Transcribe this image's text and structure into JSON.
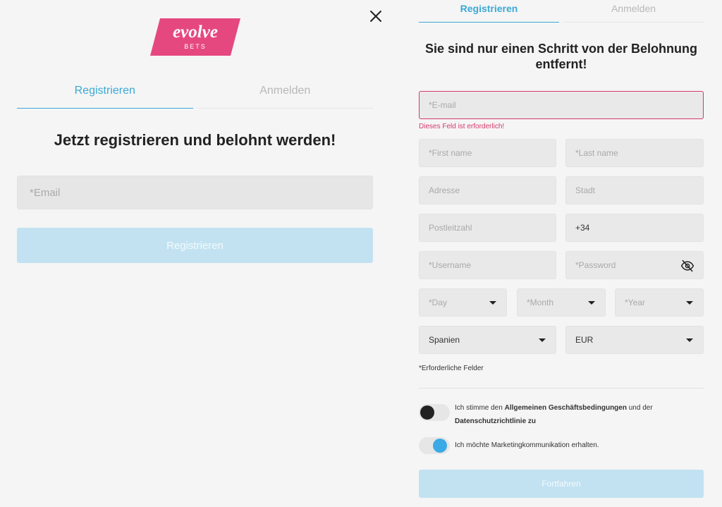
{
  "brand": {
    "logo_word": "evolve",
    "logo_sub": "BETS",
    "logo_color": "#e5487f"
  },
  "close_icon": "close-icon",
  "left_panel": {
    "tabs": [
      {
        "label": "Registrieren",
        "active": true
      },
      {
        "label": "Anmelden",
        "active": false
      }
    ],
    "headline": "Jetzt registrieren und belohnt werden!",
    "email_placeholder": "*Email",
    "submit_label": "Registrieren"
  },
  "right_panel": {
    "tabs": [
      {
        "label": "Registrieren",
        "active": true
      },
      {
        "label": "Anmelden",
        "active": false
      }
    ],
    "headline": "Sie sind nur einen Schritt von der Belohnung entfernt!",
    "email_placeholder": "*E-mail",
    "email_error": "Dieses Feld ist erforderlich!",
    "first_name_placeholder": "*First name",
    "last_name_placeholder": "*Last name",
    "address_placeholder": "Adresse",
    "city_placeholder": "Stadt",
    "postcode_placeholder": "Postleitzahl",
    "phone_value": "+34",
    "username_placeholder": "*Username",
    "password_placeholder": "*Password",
    "day_placeholder": "*Day",
    "month_placeholder": "*Month",
    "year_placeholder": "*Year",
    "country_value": "Spanien",
    "currency_value": "EUR",
    "required_note": "*Erforderliche Felder",
    "terms": {
      "prefix": "Ich stimme den ",
      "terms_link": "Allgemeinen Geschäftsbedingungen",
      "middle": " und der ",
      "privacy_link": "Datenschutzrichtlinie zu",
      "checked": false
    },
    "marketing": {
      "label": "Ich möchte Marketingkommunikation erhalten.",
      "checked": true
    },
    "submit_label": "Fortfahren"
  },
  "colors": {
    "accent": "#3aa9d6",
    "error": "#d43a6a",
    "button_disabled": "#c2e2f2"
  }
}
